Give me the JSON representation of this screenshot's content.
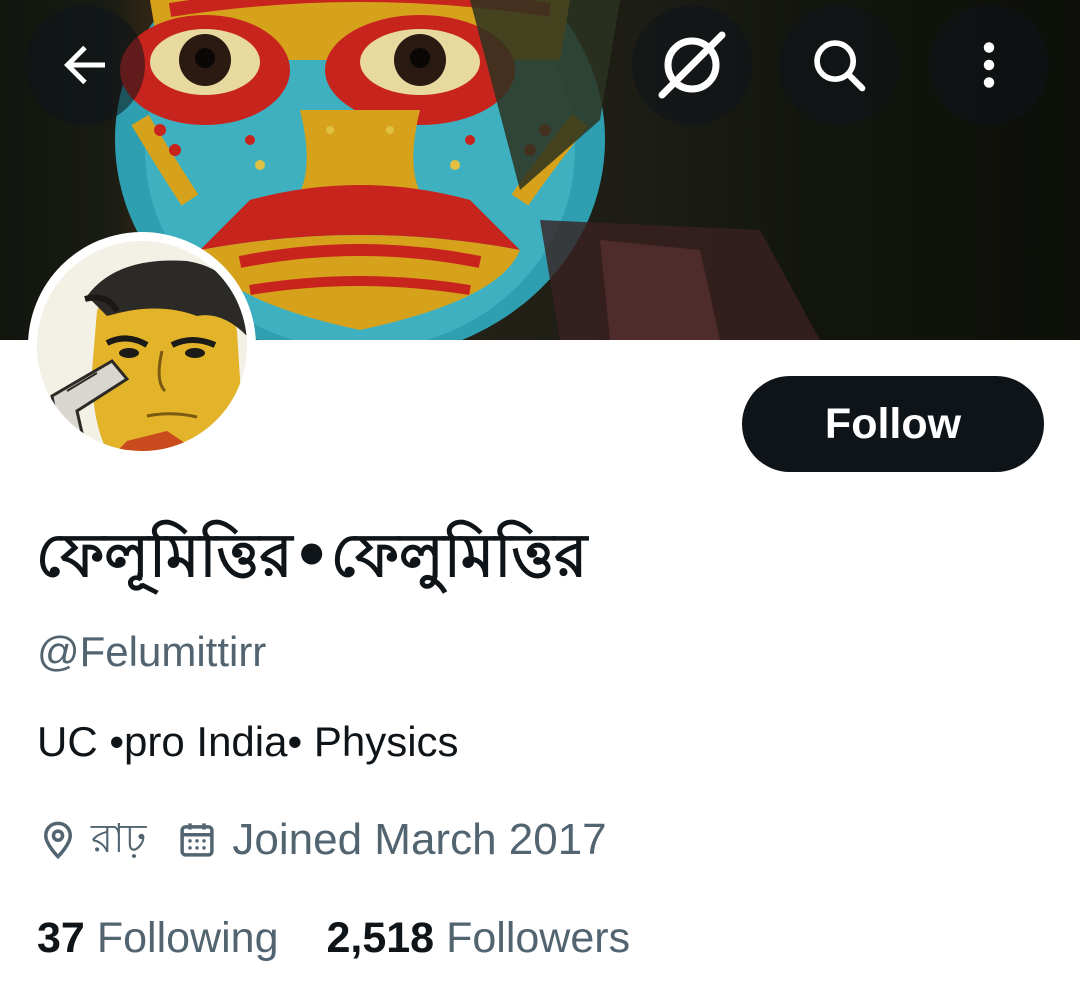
{
  "header": {
    "back_icon": "arrow-left-icon",
    "grok_icon": "grok-icon",
    "search_icon": "search-icon",
    "more_icon": "more-vertical-icon"
  },
  "profile": {
    "display_name": "ফেলূমিত্তির•ফেলুমিত্তির",
    "handle": "@Felumittirr",
    "bio": "UC •pro India• Physics",
    "location": "রাঢ়",
    "joined": "Joined March 2017",
    "following_count": "37",
    "following_label": "Following",
    "followers_count": "2,518",
    "followers_label": "Followers"
  },
  "actions": {
    "follow_label": "Follow"
  },
  "colors": {
    "primary_text": "#0f1419",
    "secondary_text": "#536471",
    "follow_bg": "#0f1419"
  }
}
